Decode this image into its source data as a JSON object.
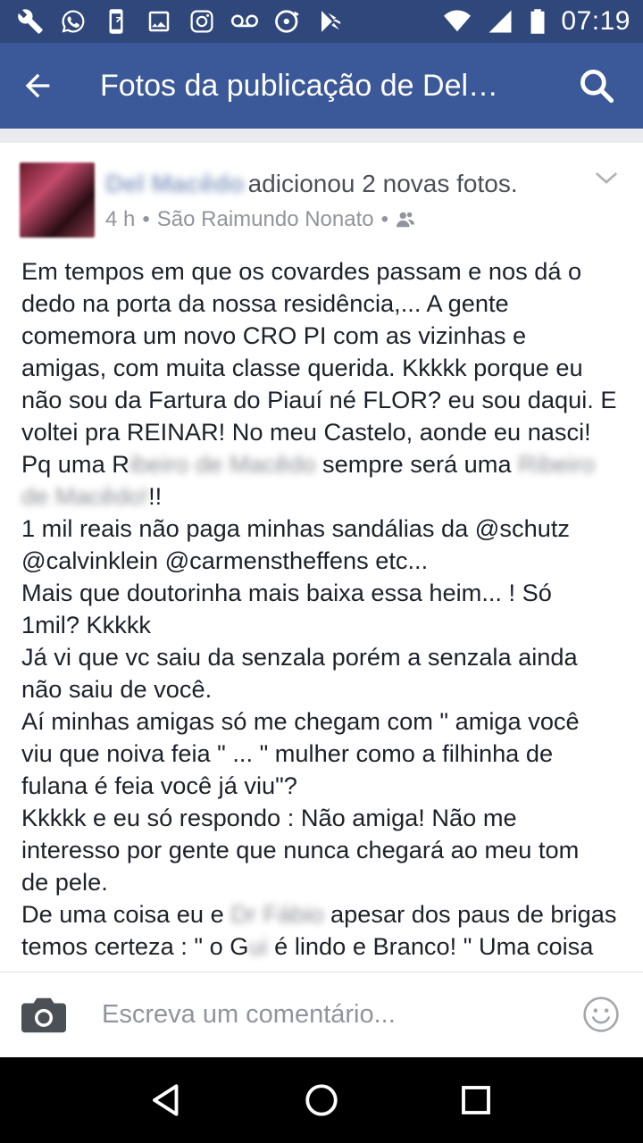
{
  "statusbar": {
    "time": "07:19",
    "left_icons": [
      "wrench-icon",
      "whatsapp-icon",
      "phone-app-icon",
      "image-icon",
      "instagram-icon",
      "voicemail-icon",
      "music-icon",
      "play-store-icon"
    ],
    "right_icons": [
      "wifi-icon",
      "signal-icon",
      "battery-icon"
    ]
  },
  "appbar": {
    "title": "Fotos da publicação de Del…",
    "back_icon": "arrow-back-icon",
    "search_icon": "search-icon",
    "color": "#3b5998"
  },
  "post": {
    "author": "Del Macêdo",
    "action": "adicionou 2 novas fotos.",
    "time": "4 h",
    "separator": "•",
    "location": "São Raimundo Nonato",
    "audience_icon": "friends-icon",
    "menu_icon": "chevron-down-icon",
    "body": {
      "p1_l1": "Em tempos em que os covardes passam e nos dá o",
      "p1_l2": "dedo na porta da nossa residência,... A gente",
      "p1_l3": "comemora um novo CRO PI com as vizinhas e",
      "p1_l4": "amigas, com muita classe querida. Kkkkk porque eu",
      "p1_l5": "não sou da Fartura do Piauí né FLOR?  eu sou daqui. E",
      "p1_l6": "voltei pra REINAR! No meu Castelo, aonde eu nasci!",
      "p1_l7a": "Pq uma R",
      "p1_l7b": "ibeiro de Macêdo",
      "p1_l7c": " sempre será uma ",
      "p1_l7d": "Ribeiro",
      "p1_l8a": "de Macêdo!",
      "p1_l8b": "!!",
      "p2_l1": "1 mil reais não paga minhas sandálias da @schutz",
      "p2_l2": "@calvinklein @carmenstheffens etc...",
      "p3_l1": "Mais que doutorinha mais baixa essa heim... !  Só",
      "p3_l2": "1mil? Kkkkk",
      "p4_l1": "Já vi que vc saiu da senzala porém a senzala ainda",
      "p4_l2": "não saiu de você.",
      "p5_l1": "Aí minhas amigas só me chegam com \" amiga você",
      "p5_l2": "viu que noiva feia \" ... \" mulher como a filhinha de",
      "p5_l3": "fulana é feia você já viu\"?",
      "p6_l1": "Kkkkk e eu só respondo : Não amiga! Não me",
      "p6_l2": "interesso por gente que nunca chegará ao meu tom",
      "p6_l3": "de pele.",
      "p7_l1a": "De uma coisa eu e",
      "p7_l1b": " Dr Fábio",
      "p7_l1c": " apesar dos paus de brigas",
      "p7_l2a": "temos certeza : \" o G",
      "p7_l2b": "ui",
      "p7_l2c": " é lindo e Branco! \" Uma coisa"
    }
  },
  "comment_bar": {
    "placeholder": "Escreva um comentário...",
    "camera_icon": "camera-icon",
    "emoji_icon": "smiley-icon"
  },
  "navbar": {
    "icons": [
      "back-triangle-icon",
      "home-circle-icon",
      "recents-square-icon"
    ]
  }
}
